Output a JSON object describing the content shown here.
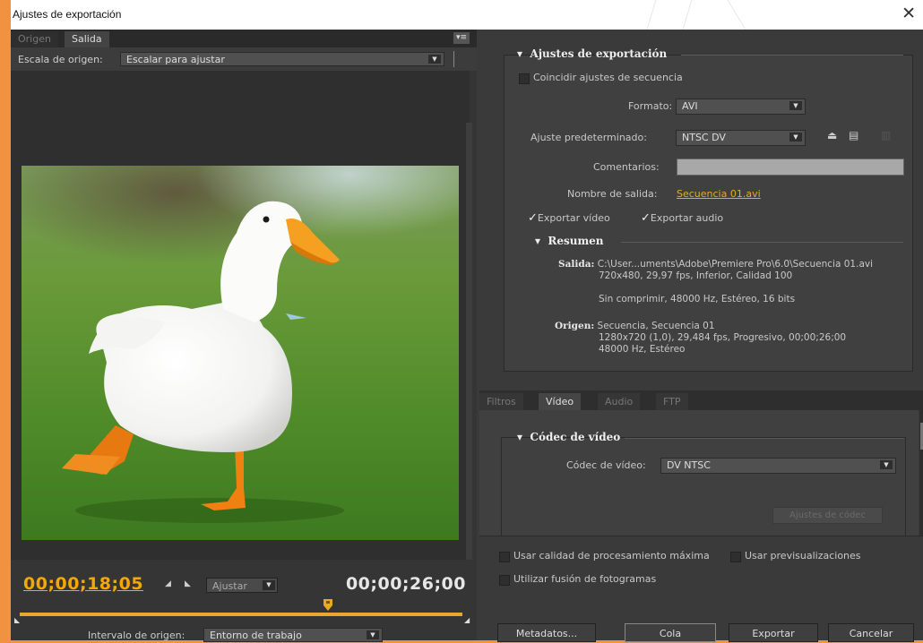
{
  "window": {
    "title": "Ajustes de exportación",
    "close_glyph": "✕"
  },
  "left": {
    "tabs": [
      "Origen",
      "Salida"
    ],
    "scale_label": "Escala de origen:",
    "scale_value": "Escalar para ajustar",
    "current_timecode": "00;00;18;05",
    "end_timecode": "00;00;26;00",
    "fit_value": "Ajustar",
    "range_label": "Intervalo de origen:",
    "range_value": "Entorno de trabajo"
  },
  "export": {
    "section_title": "Ajustes de exportación",
    "match_sequence": "Coincidir ajustes de secuencia",
    "format_label": "Formato:",
    "format_value": "AVI",
    "preset_label": "Ajuste predeterminado:",
    "preset_value": "NTSC DV",
    "comments_label": "Comentarios:",
    "output_name_label": "Nombre de salida:",
    "output_name_value": "Secuencia 01.avi",
    "export_video": "Exportar vídeo",
    "export_audio": "Exportar audio"
  },
  "summary": {
    "title": "Resumen",
    "output_label": "Salida:",
    "output_lines": [
      "C:\\User...uments\\Adobe\\Premiere Pro\\6.0\\Secuencia 01.avi",
      "720x480, 29,97 fps, Inferior, Calidad 100",
      "",
      "Sin comprimir, 48000 Hz, Estéreo, 16 bits"
    ],
    "source_label": "Origen:",
    "source_lines": [
      "Secuencia, Secuencia 01",
      "1280x720 (1,0), 29,484 fps, Progresivo, 00;00;26;00",
      "48000 Hz, Estéreo"
    ]
  },
  "tabs2": [
    "Filtros",
    "Vídeo",
    "Audio",
    "FTP"
  ],
  "codec": {
    "section_title": "Códec de vídeo",
    "codec_label": "Códec de vídeo:",
    "codec_value": "DV NTSC",
    "codec_settings": "Ajustes de códec"
  },
  "options": {
    "max_quality": "Usar calidad de procesamiento máxima",
    "use_previews": "Usar previsualizaciones",
    "frame_blending": "Utilizar fusión de fotogramas"
  },
  "buttons": {
    "metadata": "Metadatos...",
    "queue": "Cola",
    "export": "Exportar",
    "cancel": "Cancelar"
  },
  "colors": {
    "accent": "#e8a92a",
    "frame_bg": "#f0923f",
    "panel_bg": "#3a3a3a"
  }
}
